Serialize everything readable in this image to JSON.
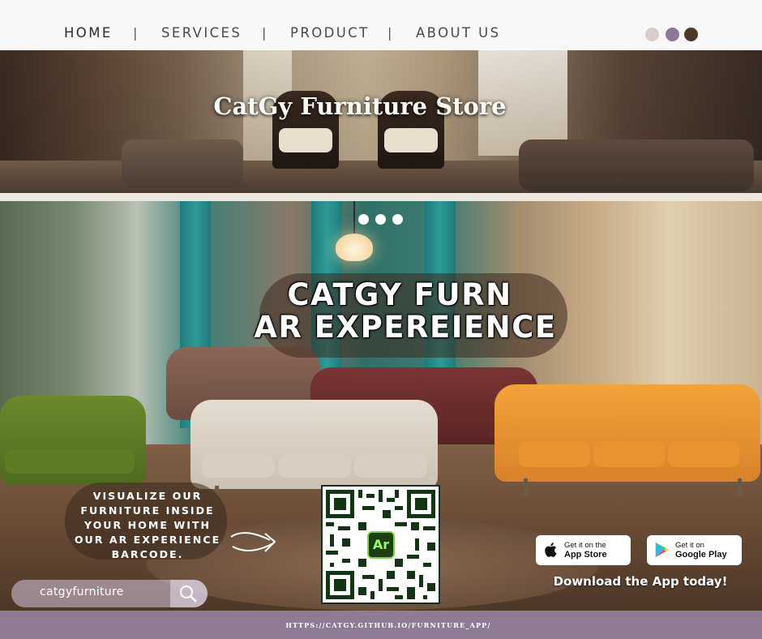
{
  "nav": {
    "items": [
      {
        "label": "HOME",
        "active": true
      },
      {
        "label": "SERVICES",
        "active": false
      },
      {
        "label": "PRODUCT",
        "active": false
      },
      {
        "label": "ABOUT US",
        "active": false
      }
    ],
    "separator": "|",
    "swatches": [
      "#d9cdc9",
      "#8d7997",
      "#4b3a2a"
    ]
  },
  "hero1": {
    "title": "CatGy Furniture Store"
  },
  "hero2": {
    "title_line1": "CATGY FURN",
    "title_line2": "AR EXPEREIENCE",
    "carousel_dots": 3,
    "visualize_lines": [
      "VISUALIZE OUR",
      "FURNITURE INSIDE",
      "YOUR HOME WITH",
      "OUR AR EXPERIENCE",
      "BARCODE."
    ],
    "qr_logo": "Ar",
    "search_value": "catgyfurniture",
    "app_store": {
      "small": "Get it on the",
      "big": "App Store",
      "icon": "apple-icon"
    },
    "google_play": {
      "small": "Get it on",
      "big": "Google Play",
      "icon": "play-icon"
    },
    "download_text": "Download the App today!"
  },
  "footer": {
    "url": "HTTPS://CATGY.GITHUB.IO/FURNITURE_APP/"
  },
  "colors": {
    "accent_purple": "#8f7b94",
    "footer_bg": "#8f7b94"
  }
}
